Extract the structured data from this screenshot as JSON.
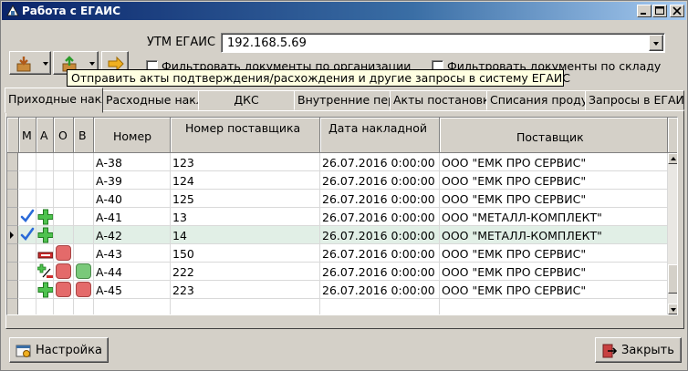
{
  "window": {
    "title": "Работа с ЕГАИС"
  },
  "toolbar": {
    "utm_label": "УТМ ЕГАИС",
    "utm_value": "192.168.5.69",
    "filter_org_label": "Фильтровать документы по организации",
    "filter_stock_label": "Фильтровать документы по складу",
    "tooltip": "Отправить акты подтверждения/расхождения и другие запросы в систему ЕГАИС"
  },
  "tabs": [
    {
      "label": "Приходные накладные"
    },
    {
      "label": "Расходные накладные"
    },
    {
      "label": "ДКС"
    },
    {
      "label": "Внутренние перемещения"
    },
    {
      "label": "Акты постановки"
    },
    {
      "label": "Списания продукции"
    },
    {
      "label": "Запросы в ЕГАИС"
    }
  ],
  "grid": {
    "columns": {
      "m": "М",
      "a": "А",
      "o": "О",
      "v": "В",
      "number": "Номер",
      "supplier_number": "Номер поставщика",
      "date": "Дата накладной",
      "supplier": "Поставщик"
    },
    "rows": [
      {
        "number": "А-38",
        "supplier_number": "123",
        "date": "26.07.2016 0:00:00",
        "supplier": "ООО \"ЕМК ПРО СЕРВИС\"",
        "m_icon": "",
        "a_icon": "",
        "o_icon": "",
        "v_icon": ""
      },
      {
        "number": "А-39",
        "supplier_number": "124",
        "date": "26.07.2016 0:00:00",
        "supplier": "ООО \"ЕМК ПРО СЕРВИС\"",
        "m_icon": "",
        "a_icon": "",
        "o_icon": "",
        "v_icon": ""
      },
      {
        "number": "А-40",
        "supplier_number": "125",
        "date": "26.07.2016 0:00:00",
        "supplier": "ООО \"ЕМК ПРО СЕРВИС\"",
        "m_icon": "",
        "a_icon": "",
        "o_icon": "",
        "v_icon": ""
      },
      {
        "number": "А-41",
        "supplier_number": "13",
        "date": "26.07.2016 0:00:00",
        "supplier": "ООО \"МЕТАЛЛ-КОМПЛЕКТ\"",
        "m_icon": "checkmark-icon",
        "a_icon": "green-plus-icon",
        "o_icon": "",
        "v_icon": ""
      },
      {
        "number": "А-42",
        "supplier_number": "14",
        "date": "26.07.2016 0:00:00",
        "supplier": "ООО \"МЕТАЛЛ-КОМПЛЕКТ\"",
        "m_icon": "checkmark-icon",
        "a_icon": "green-plus-icon",
        "o_icon": "",
        "v_icon": ""
      },
      {
        "number": "А-43",
        "supplier_number": "150",
        "date": "26.07.2016 0:00:00",
        "supplier": "ООО \"ЕМК ПРО СЕРВИС\"",
        "m_icon": "",
        "a_icon": "red-strip-icon",
        "o_icon": "red-square-icon",
        "v_icon": ""
      },
      {
        "number": "А-44",
        "supplier_number": "222",
        "date": "26.07.2016 0:00:00",
        "supplier": "ООО \"ЕМК ПРО СЕРВИС\"",
        "m_icon": "",
        "a_icon": "plus-minus-icon",
        "o_icon": "red-square-icon",
        "v_icon": "green-square-icon"
      },
      {
        "number": "А-45",
        "supplier_number": "223",
        "date": "26.07.2016 0:00:00",
        "supplier": "ООО \"ЕМК ПРО СЕРВИС\"",
        "m_icon": "",
        "a_icon": "green-plus-icon",
        "o_icon": "red-square-icon",
        "v_icon": "red-square-icon"
      }
    ]
  },
  "buttons": {
    "settings": "Настройка",
    "close": "Закрыть"
  },
  "colors": {
    "selected_row": "#e1efe6",
    "tooltip_bg": "#ffffe1",
    "title_bar": "#0a246a"
  }
}
